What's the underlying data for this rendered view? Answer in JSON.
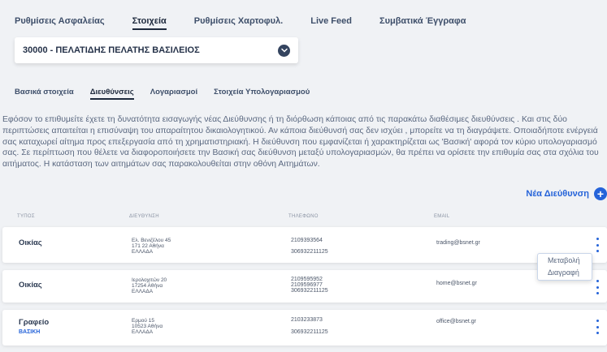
{
  "top_tabs": [
    {
      "label": "Ρυθμίσεις Ασφαλείας"
    },
    {
      "label": "Στοιχεία"
    },
    {
      "label": "Ρυθμίσεις Χαρτοφυλ."
    },
    {
      "label": "Live Feed"
    },
    {
      "label": "Συμβατικά Έγγραφα"
    }
  ],
  "account": {
    "label": "30000 - ΠΕΛΑΤΙΔΗΣ ΠΕΛΑΤΗΣ ΒΑΣΙΛΕΙΟΣ"
  },
  "sub_tabs": [
    {
      "label": "Βασικά στοιχεία"
    },
    {
      "label": "Διευθύνσεις"
    },
    {
      "label": "Λογαριασμοί"
    },
    {
      "label": "Στοιχεία Υπολογαριασμού"
    }
  ],
  "description": "Εφόσον το επιθυμείτε έχετε τη δυνατότητα εισαγωγής νέας Διεύθυνσης ή τη διόρθωση κάποιας από τις παρακάτω διαθέσιμες διευθύνσεις . Και στις δύο περιπτώσεις απαιτείται η επισύναψη του απαραίτητου δικαιολογητικού. Αν κάποια διεύθυνσή σας δεν ισχύει , μπορείτε να τη διαγράψετε. Οποιαδήποτε ενέργειά σας καταχωρεί αίτημα προς επεξεργασία από τη χρηματιστηριακή. Η διεύθυνση που εμφανίζεται ή χαρακτηρίζεται ως 'Βασική' αφορά τον κύριο υπολογαριασμό σας. Σε περίπτωση που θέλετε να διαφοροποιήσετε την Βασική σας διεύθυνση μεταξύ υπολογαριασμών, θα πρέπει να ορίσετε την επιθυμία σας στα σχόλια του αιτήματος. Η κατάσταση των αιτημάτων σας παρακολουθείται στην οθόνη Αιτημάτων.",
  "new_address": {
    "label": "Νέα Διεύθυνση",
    "icon": "+"
  },
  "columns": {
    "type": "ΤΥΠΟΣ",
    "address": "ΔΙΕΥΘΥΝΣΗ",
    "phone": "ΤΗΛΕΦΩΝΟ",
    "email": "EMAIL"
  },
  "rows": [
    {
      "type": "Οικίας",
      "badge": "",
      "address": [
        "Ελ. Βενιζέλου 45",
        "171 22 Αθήνα",
        "ΕΛΛΑΔΑ"
      ],
      "phones": [
        "2109393564",
        "306932211125"
      ],
      "email": "trading@bsnet.gr"
    },
    {
      "type": "Οικίας",
      "badge": "",
      "address": [
        "Ιερολοχιτών 20",
        "17254 Αθήνα",
        "ΕΛΛΑΔΑ"
      ],
      "phones": [
        "2109595952",
        "2109596977",
        "306932211125"
      ],
      "email": "home@bsnet.gr"
    },
    {
      "type": "Γραφείο",
      "badge": "ΒΑΣΙΚΗ",
      "address": [
        "Ερμού 15",
        "10523 Αθήνα",
        "ΕΛΛΑΔΑ"
      ],
      "phones": [
        "2103233873",
        "306932211125"
      ],
      "email": "office@bsnet.gr"
    }
  ],
  "row_menu": {
    "edit": "Μεταβολή",
    "delete": "Διαγραφή"
  },
  "colors": {
    "accent": "#2563d9",
    "dark": "#1e2a3d",
    "background": "#f0f2f5"
  }
}
